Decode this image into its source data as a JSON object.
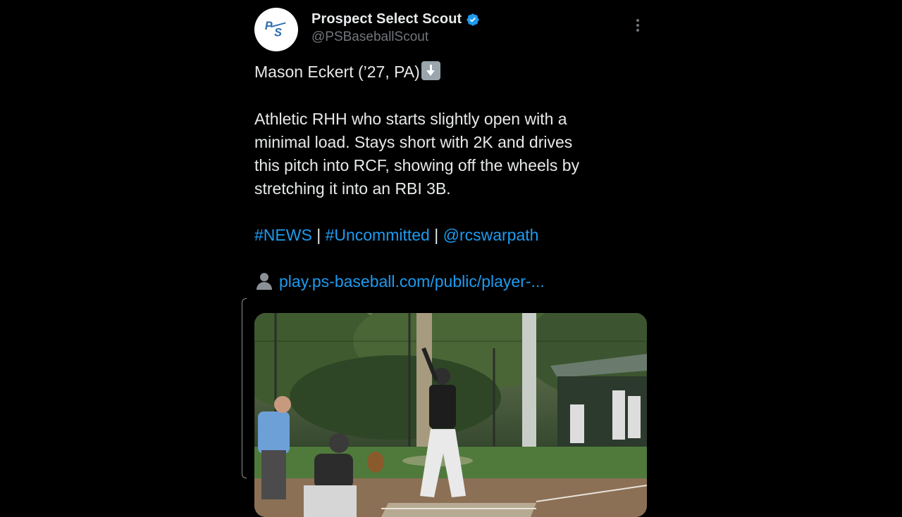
{
  "author": {
    "display_name": "Prospect Select Scout",
    "handle": "@PSBaseballScout",
    "avatar_logo_text": "PS",
    "verified_color": "#1d9bf0"
  },
  "tweet": {
    "title_line": "Mason Eckert (’27, PA)",
    "body_lines": [
      "Athletic RHH who starts slightly open with a",
      "minimal load. Stays short with 2K and drives",
      "this pitch into RCF, showing off the wheels by",
      "stretching it into an RBI 3B."
    ],
    "hashtags": [
      "#NEWS",
      "#Uncommitted"
    ],
    "mention": "@rcswarpath",
    "separator": "|",
    "link_text": "play.ps-baseball.com/public/player-..."
  },
  "icons": {
    "more": "more-vertical-icon",
    "verified": "verified-badge-icon",
    "arrow": "down-arrow-emoji",
    "person": "bust-silhouette-emoji"
  },
  "colors": {
    "background": "#000000",
    "text": "#e7e9ea",
    "secondary": "#71767b",
    "link": "#1d9bf0"
  },
  "media": {
    "kind": "video-still"
  }
}
